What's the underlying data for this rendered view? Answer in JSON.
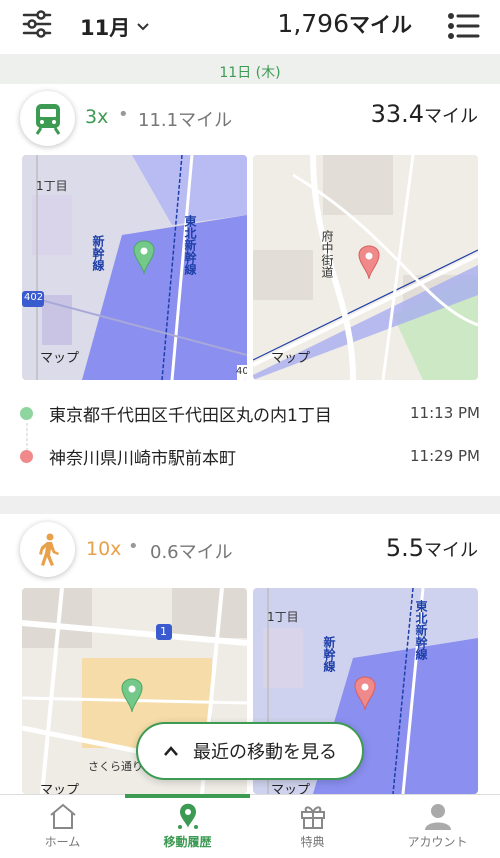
{
  "header": {
    "month": "11月",
    "total_miles": "1,796",
    "total_unit": "マイル"
  },
  "date_label": "11日 (木)",
  "trips": [
    {
      "mode": "train",
      "multiplier": "3x",
      "base_miles": "11.1マイル",
      "earned": "33.4",
      "unit": "マイル",
      "maps": [
        {
          "labels": [
            "1丁目",
            "東北新幹線",
            "新幹線",
            "402",
            "40"
          ],
          "brand": "マップ"
        },
        {
          "labels": [
            "府中街道"
          ],
          "brand": "マップ"
        }
      ],
      "start": {
        "address": "東京都千代田区千代田区丸の内1丁目",
        "time": "11:13 PM"
      },
      "end": {
        "address": "神奈川県川崎市駅前本町",
        "time": "11:29 PM"
      }
    },
    {
      "mode": "walk",
      "multiplier": "10x",
      "base_miles": "0.6マイル",
      "earned": "5.5",
      "unit": "マイル",
      "maps": [
        {
          "labels": [
            "1",
            "さくら通り"
          ],
          "brand": "マップ"
        },
        {
          "labels": [
            "1丁目",
            "東北新幹線",
            "新幹線"
          ],
          "brand": "マップ"
        }
      ]
    }
  ],
  "float_button": "最近の移動を見る",
  "tabs": [
    {
      "label": "ホーム",
      "icon": "home-icon"
    },
    {
      "label": "移動履歴",
      "icon": "location-icon"
    },
    {
      "label": "特典",
      "icon": "gift-icon"
    },
    {
      "label": "アカウント",
      "icon": "account-icon"
    }
  ],
  "colors": {
    "accent": "#3d9a52",
    "train": "#3d9a52",
    "walk": "#e8a04a",
    "start_dot": "#8fd5a0",
    "end_dot": "#f08a8a"
  }
}
